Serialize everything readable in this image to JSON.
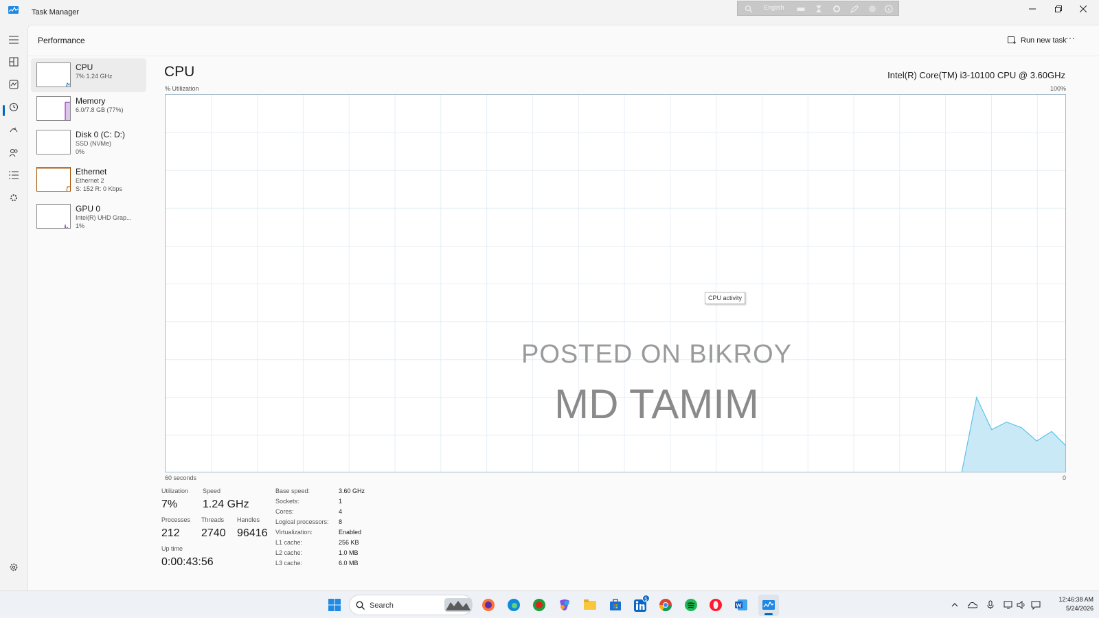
{
  "window": {
    "title": "Task Manager",
    "language_bar_label": "English"
  },
  "header": {
    "title": "Performance",
    "run_new_task": "Run new task",
    "more": "···"
  },
  "devices": [
    {
      "name": "CPU",
      "line1": "7% 1.24 GHz",
      "line2": "",
      "color": "#117dbb"
    },
    {
      "name": "Memory",
      "line1": "6.0/7.8 GB (77%)",
      "line2": "",
      "color": "#8b12ae"
    },
    {
      "name": "Disk 0 (C: D:)",
      "line1": "SSD (NVMe)",
      "line2": "0%",
      "color": "#4da60c"
    },
    {
      "name": "Ethernet",
      "line1": "Ethernet 2",
      "line2": "S: 152 R: 0 Kbps",
      "color": "#a74f01"
    },
    {
      "name": "GPU 0",
      "line1": "Intel(R) UHD Grap...",
      "line2": "1%",
      "color": "#8e44ad"
    }
  ],
  "main": {
    "title": "CPU",
    "model": "Intel(R) Core(TM) i3-10100 CPU @ 3.60GHz",
    "axis_top_left": "% Utilization",
    "axis_top_right": "100%",
    "axis_bottom_left": "60 seconds",
    "axis_bottom_right": "0",
    "tooltip": "CPU activity",
    "watermark_line1": "POSTED ON BIKROY",
    "watermark_line2": "MD TAMIM",
    "graph_fill": "#c9e9f6",
    "graph_stroke": "#5fc1e6"
  },
  "chart_data": {
    "type": "area",
    "ylabel": "% Utilization",
    "xlabel": "60 seconds",
    "xlim": [
      60,
      0
    ],
    "ylim": [
      0,
      100
    ],
    "x": [
      7,
      6,
      5,
      4,
      3,
      2,
      1,
      0
    ],
    "values": [
      0,
      20,
      11.5,
      13.5,
      12,
      8.5,
      11,
      7
    ]
  },
  "stats": {
    "utilization_label": "Utilization",
    "utilization_value": "7%",
    "speed_label": "Speed",
    "speed_value": "1.24 GHz",
    "processes_label": "Processes",
    "processes_value": "212",
    "threads_label": "Threads",
    "threads_value": "2740",
    "handles_label": "Handles",
    "handles_value": "96416",
    "uptime_label": "Up time",
    "uptime_value": "0:00:43:56"
  },
  "specs": [
    {
      "key": "Base speed:",
      "value": "3.60 GHz"
    },
    {
      "key": "Sockets:",
      "value": "1"
    },
    {
      "key": "Cores:",
      "value": "4"
    },
    {
      "key": "Logical processors:",
      "value": "8"
    },
    {
      "key": "Virtualization:",
      "value": "Enabled"
    },
    {
      "key": "L1 cache:",
      "value": "256 KB"
    },
    {
      "key": "L2 cache:",
      "value": "1.0 MB"
    },
    {
      "key": "L3 cache:",
      "value": "6.0 MB"
    }
  ],
  "taskbar": {
    "search_placeholder": "Search",
    "linkedin_badge": "5",
    "time": "12:46:38 AM",
    "date": "5/24/2026"
  }
}
